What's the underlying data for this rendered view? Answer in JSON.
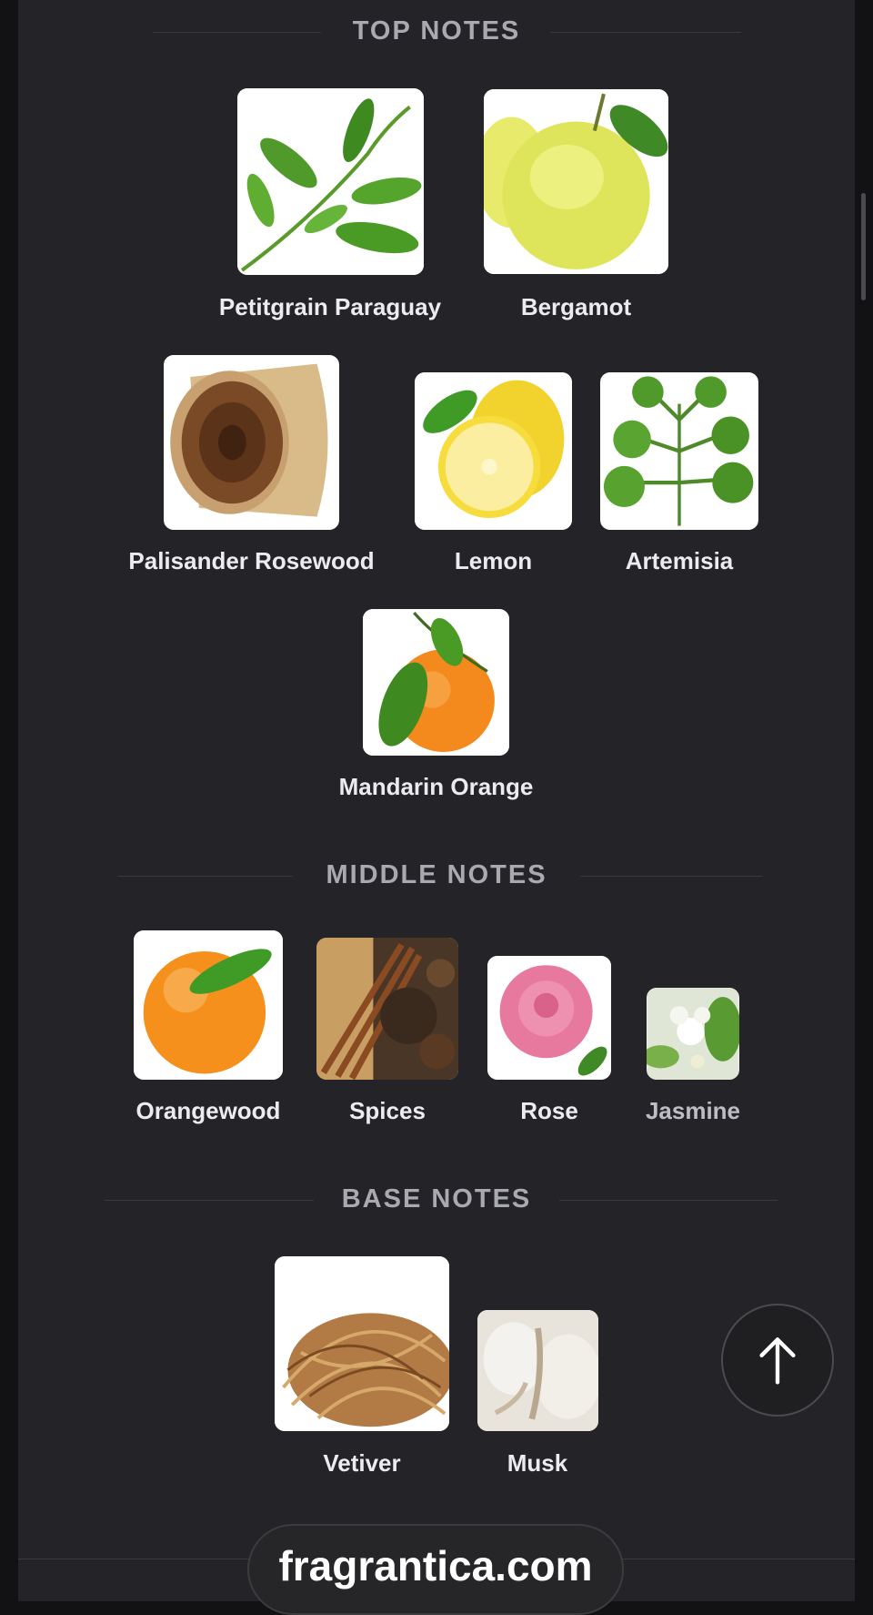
{
  "sections": {
    "top": {
      "title": "TOP NOTES",
      "notes": [
        "Petitgrain Paraguay",
        "Bergamot",
        "Palisander Rosewood",
        "Lemon",
        "Artemisia",
        "Mandarin Orange"
      ]
    },
    "middle": {
      "title": "MIDDLE NOTES",
      "notes": [
        "Orangewood",
        "Spices",
        "Rose",
        "Jasmine"
      ]
    },
    "base": {
      "title": "BASE NOTES",
      "notes": [
        "Vetiver",
        "Musk"
      ]
    }
  },
  "footer": {
    "brand": "fragrantica.com"
  },
  "icons": {
    "scroll_top": "arrow-up-icon"
  },
  "colors": {
    "background": "#242428",
    "heading": "#a9a9b0",
    "label": "#ececef"
  }
}
